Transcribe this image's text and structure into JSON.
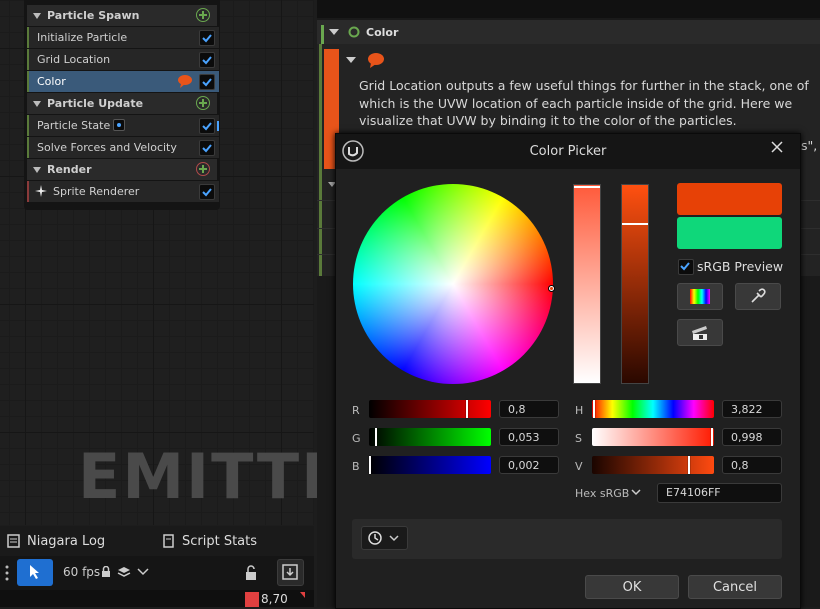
{
  "emitter": {
    "sections": [
      {
        "label": "Particle Spawn",
        "items": [
          {
            "label": "Initialize Particle"
          },
          {
            "label": "Grid Location"
          },
          {
            "label": "Color"
          }
        ]
      },
      {
        "label": "Particle Update",
        "items": [
          {
            "label": "Particle State"
          },
          {
            "label": "Solve Forces and Velocity"
          }
        ]
      },
      {
        "label": "Render",
        "items": [
          {
            "label": "Sprite Renderer"
          }
        ]
      }
    ],
    "watermark": "EMITTER"
  },
  "bottom_tabs": {
    "log": "Niagara Log",
    "stats": "Script Stats"
  },
  "toolbar": {
    "fps": "60 fps",
    "stat_value": "8,70"
  },
  "details": {
    "section_title": "Color",
    "description": "Grid Location outputs a few useful things for further in the stack, one of which is the UVW location of each particle inside of the grid. Here we visualize that UVW by binding it to the color of the particles.",
    "partial_text": "s\","
  },
  "color_picker": {
    "title": "Color Picker",
    "srgb_preview_label": "sRGB Preview",
    "srgb_preview_checked": true,
    "new_color": "#E74106",
    "old_color": "#0FD77A",
    "rgb": {
      "r_label": "R",
      "r": "0,8",
      "g_label": "G",
      "g": "0,053",
      "b_label": "B",
      "b": "0,002"
    },
    "hsv": {
      "h_label": "H",
      "h": "3,822",
      "s_label": "S",
      "s": "0,998",
      "v_label": "V",
      "v": "0,8"
    },
    "hex_label": "Hex sRGB",
    "hex_value": "E74106FF",
    "ok": "OK",
    "cancel": "Cancel"
  },
  "colors": {
    "accent": "#1f6fd1",
    "node_green": "#6aa84f",
    "selected_row": "#3a5a7a"
  }
}
